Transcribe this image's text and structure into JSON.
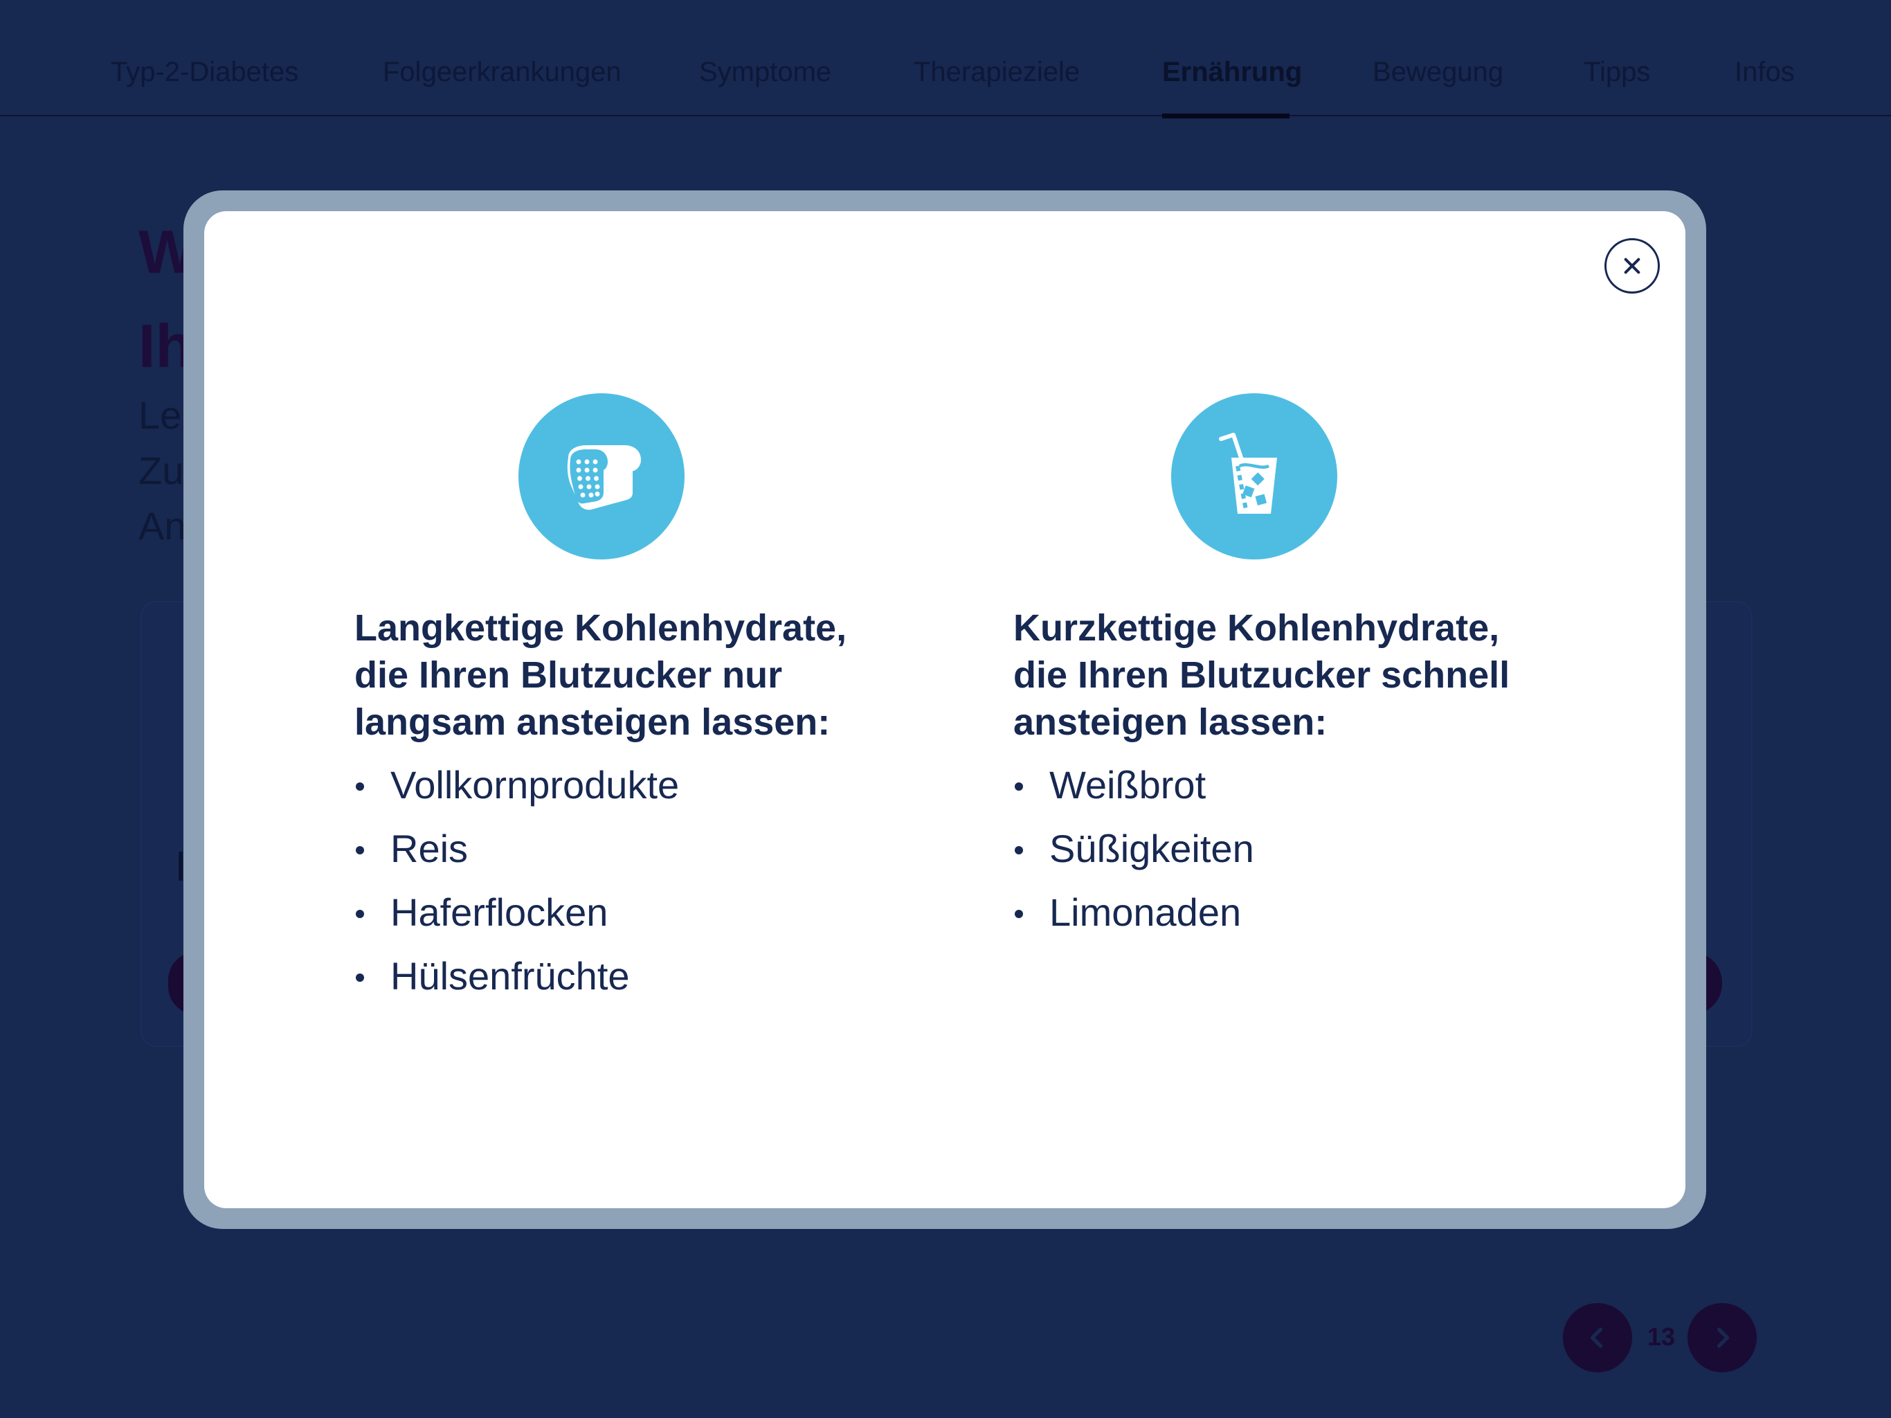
{
  "nav": {
    "items": [
      {
        "label": "Typ-2-Diabetes",
        "active": false
      },
      {
        "label": "Folgeerkrankungen",
        "active": false
      },
      {
        "label": "Symptome",
        "active": false
      },
      {
        "label": "Therapieziele",
        "active": false
      },
      {
        "label": "Ernährung",
        "active": true
      },
      {
        "label": "Bewegung",
        "active": false
      },
      {
        "label": "Tipps",
        "active": false
      },
      {
        "label": "Infos",
        "active": false
      }
    ]
  },
  "background": {
    "heading_lines": [
      "W",
      "Ih"
    ],
    "lead_lines": [
      "Le",
      "Zu",
      "An"
    ]
  },
  "pager": {
    "page_number": "13"
  },
  "modal": {
    "close_icon": "close-icon",
    "left": {
      "icon": "bread-icon",
      "title": "Langkettige Kohlenhydrate,\ndie Ihren Blutzucker nur\nlangsam ansteigen lassen:",
      "items": [
        "Vollkornprodukte",
        "Reis",
        "Haferflocken",
        "Hülsenfrüchte"
      ]
    },
    "right": {
      "icon": "soft-drink-icon",
      "title": "Kurzkettige Kohlenhydrate,\ndie Ihren Blutzucker schnell\nansteigen lassen:",
      "items": [
        "Weißbrot",
        "Süßigkeiten",
        "Limonaden"
      ]
    }
  },
  "colors": {
    "page_background": "#172851",
    "modal_frame": "#8ea2b8",
    "icon_circle": "#4fbde2",
    "text_dark": "#172851",
    "pager_button": "#1a0b34"
  }
}
